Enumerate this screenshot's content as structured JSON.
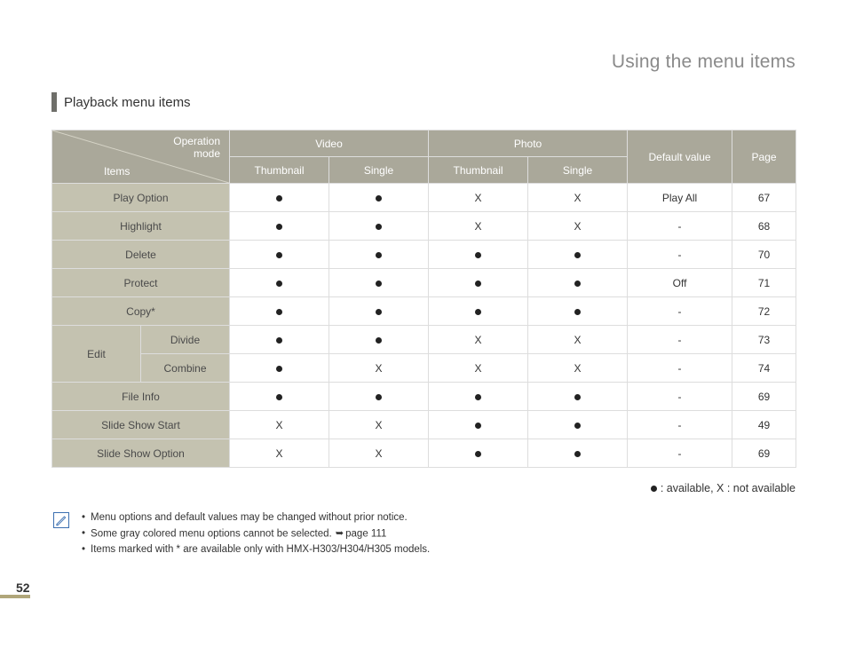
{
  "section_title": "Using the menu items",
  "subheading": "Playback menu items",
  "corner": {
    "operation_mode": "Operation\nmode",
    "items": "Items"
  },
  "headers": {
    "video": "Video",
    "photo": "Photo",
    "video_thumbnail": "Thumbnail",
    "video_single": "Single",
    "photo_thumbnail": "Thumbnail",
    "photo_single": "Single",
    "default_value": "Default value",
    "page": "Page"
  },
  "rows": [
    {
      "label": "Play Option",
      "cells": [
        "●",
        "●",
        "X",
        "X"
      ],
      "default": "Play All",
      "page": "67"
    },
    {
      "label": "Highlight",
      "cells": [
        "●",
        "●",
        "X",
        "X"
      ],
      "default": "-",
      "page": "68"
    },
    {
      "label": "Delete",
      "cells": [
        "●",
        "●",
        "●",
        "●"
      ],
      "default": "-",
      "page": "70"
    },
    {
      "label": "Protect",
      "cells": [
        "●",
        "●",
        "●",
        "●"
      ],
      "default": "Off",
      "page": "71"
    },
    {
      "label": "Copy*",
      "cells": [
        "●",
        "●",
        "●",
        "●"
      ],
      "default": "-",
      "page": "72"
    },
    {
      "group": "Edit",
      "sub": "Divide",
      "cells": [
        "●",
        "●",
        "X",
        "X"
      ],
      "default": "-",
      "page": "73"
    },
    {
      "group": "Edit",
      "sub": "Combine",
      "cells": [
        "●",
        "X",
        "X",
        "X"
      ],
      "default": "-",
      "page": "74"
    },
    {
      "label": "File Info",
      "cells": [
        "●",
        "●",
        "●",
        "●"
      ],
      "default": "-",
      "page": "69"
    },
    {
      "label": "Slide Show Start",
      "cells": [
        "X",
        "X",
        "●",
        "●"
      ],
      "default": "-",
      "page": "49"
    },
    {
      "label": "Slide Show Option",
      "cells": [
        "X",
        "X",
        "●",
        "●"
      ],
      "default": "-",
      "page": "69"
    }
  ],
  "edit_group_label": "Edit",
  "legend": "● : available, X : not available",
  "notes": [
    "Menu options and default values may be changed without prior notice.",
    "Some gray colored menu options cannot be selected. ➥page 111",
    "Items marked with * are available only with HMX-H303/H304/H305 models."
  ],
  "page_number": "52"
}
